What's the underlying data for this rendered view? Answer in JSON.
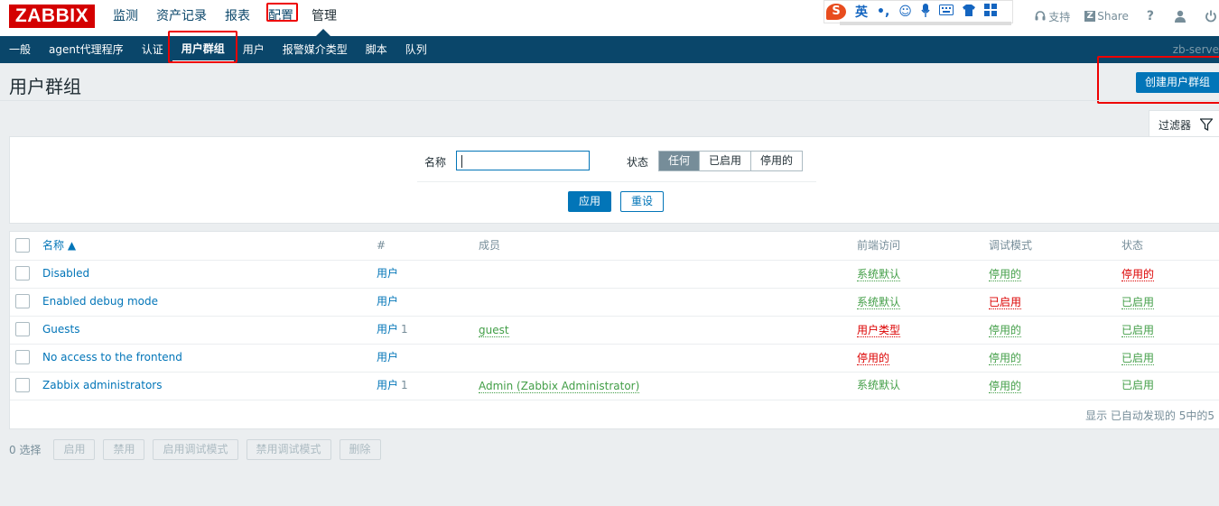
{
  "logo": "ZABBIX",
  "main_nav": [
    {
      "label": "监测"
    },
    {
      "label": "资产记录"
    },
    {
      "label": "报表"
    },
    {
      "label": "配置"
    },
    {
      "label": "管理"
    }
  ],
  "ime": {
    "logo": "S",
    "items": [
      "英",
      "•,",
      "☺",
      "🎤",
      "⌨",
      "👕",
      "▦"
    ]
  },
  "top_links": {
    "support": "支持",
    "share": "Share",
    "help": "?",
    "profile_icon": "user-icon",
    "logout_icon": "power-icon"
  },
  "sub_nav": [
    {
      "label": "一般"
    },
    {
      "label": "agent代理程序"
    },
    {
      "label": "认证"
    },
    {
      "label": "用户群组"
    },
    {
      "label": "用户"
    },
    {
      "label": "报警媒介类型"
    },
    {
      "label": "脚本"
    },
    {
      "label": "队列"
    }
  ],
  "server_name": "zb-serve",
  "page_title": "用户群组",
  "create_button": "创建用户群组",
  "filter": {
    "tab_label": "过滤器",
    "name_label": "名称",
    "name_value": "",
    "status_label": "状态",
    "status_options": [
      "任何",
      "已启用",
      "停用的"
    ],
    "status_selected": "任何",
    "apply": "应用",
    "reset": "重设"
  },
  "table": {
    "headers": {
      "name": "名称 ▲",
      "count": "#",
      "members": "成员",
      "frontend": "前端访问",
      "debug": "调试模式",
      "status": "状态"
    },
    "rows": [
      {
        "name": "Disabled",
        "users": "用户",
        "count": "",
        "members": "",
        "frontend": "系统默认",
        "debug": "停用的",
        "status": "停用的"
      },
      {
        "name": "Enabled debug mode",
        "users": "用户",
        "count": "",
        "members": "",
        "frontend": "系统默认",
        "debug": "已启用",
        "status": "已启用"
      },
      {
        "name": "Guests",
        "users": "用户",
        "count": "1",
        "members": "guest",
        "frontend": "用户类型",
        "debug": "停用的",
        "status": "已启用"
      },
      {
        "name": "No access to the frontend",
        "users": "用户",
        "count": "",
        "members": "",
        "frontend": "停用的",
        "debug": "停用的",
        "status": "已启用"
      },
      {
        "name": "Zabbix administrators",
        "users": "用户",
        "count": "1",
        "members": "Admin (Zabbix Administrator)",
        "frontend": "系统默认",
        "debug": "停用的",
        "status": "已启用"
      }
    ],
    "footer": "显示 已自动发现的 5中的5"
  },
  "bulk": {
    "selected": "0 选择",
    "buttons": [
      "启用",
      "禁用",
      "启用调试模式",
      "禁用调试模式",
      "删除"
    ]
  }
}
